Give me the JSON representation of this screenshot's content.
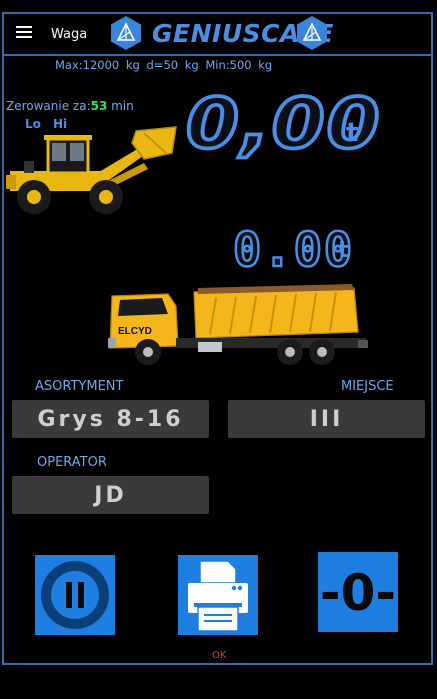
{
  "header": {
    "menu_icon": "hamburger-menu-icon",
    "section_label": "Waga",
    "brand": "GENIUSCALE",
    "brand_color": "#4a8fe6",
    "border_color": "#2f6fb0"
  },
  "specs": {
    "text": "Max:12000 kg  d=50 kg  Min:500 kg"
  },
  "zeroing": {
    "label": "Zerowanie za:",
    "minutes": "53",
    "unit": "min",
    "lo": "Lo",
    "hi": "Hi"
  },
  "main_weight": {
    "value": "0,00",
    "unit": "t"
  },
  "secondary_weight": {
    "value": "0.00",
    "unit": "t"
  },
  "truck": {
    "cab_text": "ELCYD"
  },
  "fields": {
    "assortment_label": "ASORTYMENT",
    "assortment_value": "Grys 8-16",
    "place_label": "MIEJSCE",
    "place_value": "III",
    "operator_label": "OPERATOR",
    "operator_value": "JD"
  },
  "actions": {
    "pause_icon": "pause-icon",
    "print_icon": "printer-icon",
    "zero_icon": "zero-icon",
    "zero_text": "-0-",
    "button_color": "#1f7fe0"
  },
  "status": {
    "text": "OK",
    "color": "#d84a3a"
  }
}
